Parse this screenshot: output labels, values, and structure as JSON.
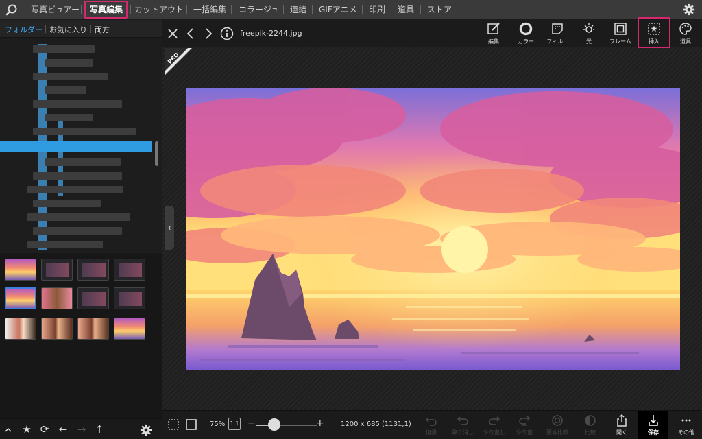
{
  "menubar": {
    "tabs": [
      "写真ビュアー",
      "写真編集",
      "カットアウト",
      "一括編集",
      "コラージュ",
      "連結",
      "GIFアニメ",
      "印刷",
      "道具",
      "ストア"
    ],
    "active_tab": "写真編集"
  },
  "left_panel": {
    "tabs": [
      "フォルダー",
      "お気に入り",
      "両方"
    ],
    "active_tab": "フォルダー"
  },
  "viewer": {
    "filename": "freepik-2244.jpg",
    "pro_badge": "PRO",
    "tools": [
      {
        "label": "編集",
        "icon": "edit-icon"
      },
      {
        "label": "カラー",
        "icon": "color-ring-icon"
      },
      {
        "label": "フィル...",
        "icon": "filter-icon"
      },
      {
        "label": "光",
        "icon": "sun-icon"
      },
      {
        "label": "フレーム",
        "icon": "frame-icon"
      },
      {
        "label": "挿入",
        "icon": "insert-icon"
      },
      {
        "label": "道具",
        "icon": "palette-icon"
      }
    ],
    "highlight_color": "#d6286e"
  },
  "status": {
    "zoom": "75%",
    "one_to_one": "1:1",
    "zoom_fraction": 0.3,
    "dimensions": "1200 x 685 (1131,1)",
    "actions": [
      {
        "label": "復帰",
        "enabled": false
      },
      {
        "label": "取り消し",
        "enabled": false
      },
      {
        "label": "やり直し",
        "enabled": false
      },
      {
        "label": "やり直",
        "enabled": false
      },
      {
        "label": "原本比較",
        "enabled": false
      },
      {
        "label": "比較",
        "enabled": false
      },
      {
        "label": "開く",
        "enabled": true
      },
      {
        "label": "保存",
        "enabled": true
      },
      {
        "label": "その他",
        "enabled": true
      }
    ]
  },
  "colors": {
    "accent": "#3da9f5",
    "selection": "#2f9be0",
    "highlight": "#d6286e"
  }
}
